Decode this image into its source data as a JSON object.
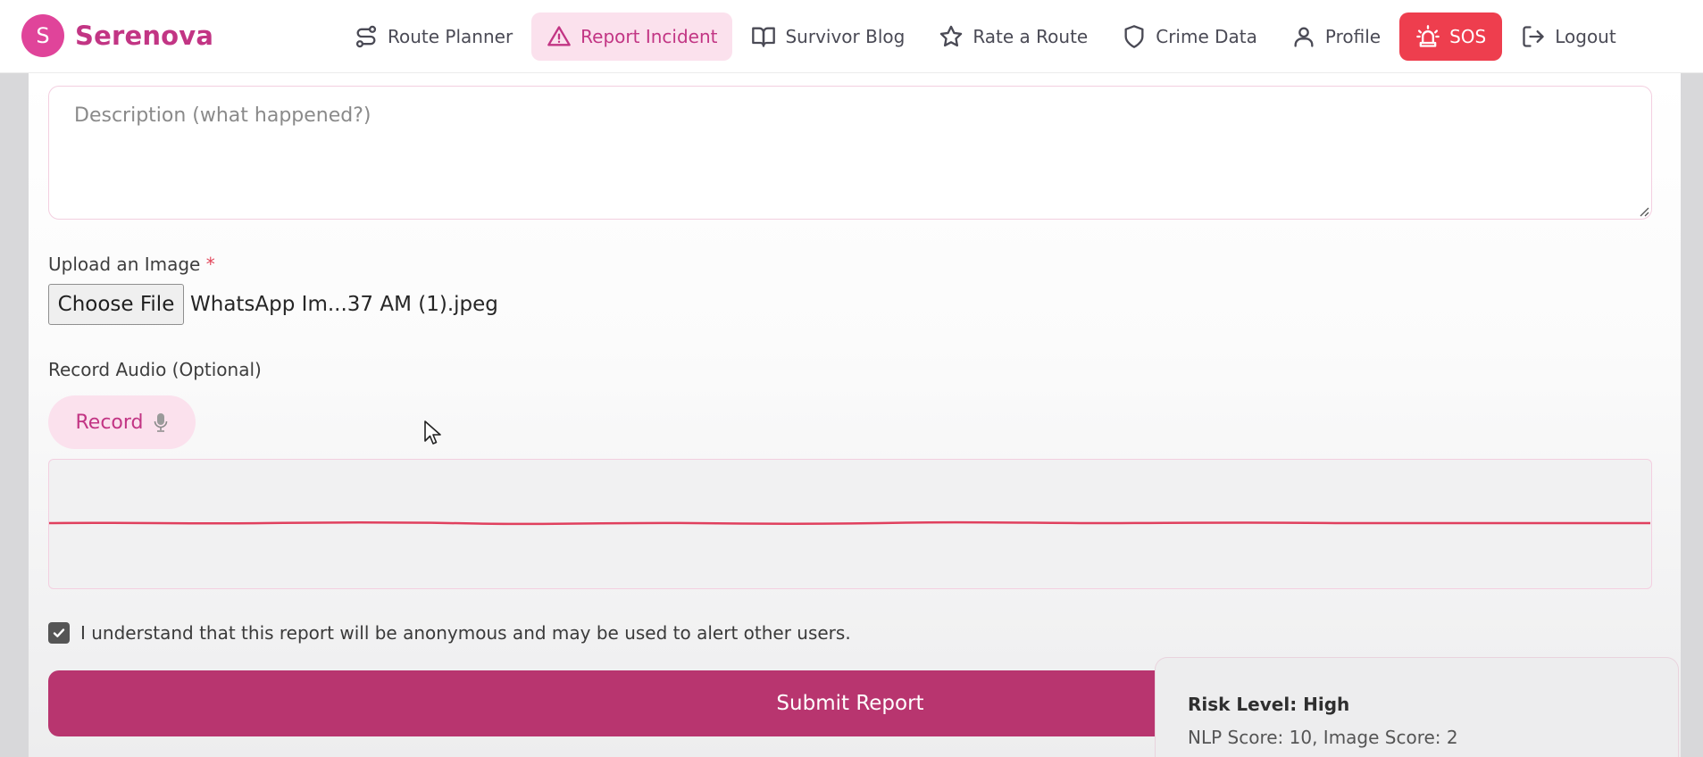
{
  "brand": {
    "logo_letter": "S",
    "name": "Serenova"
  },
  "nav": {
    "items": [
      {
        "label": "Route Planner",
        "icon": "route-icon"
      },
      {
        "label": "Report Incident",
        "icon": "warning-triangle-icon",
        "active": true
      },
      {
        "label": "Survivor Blog",
        "icon": "book-icon"
      },
      {
        "label": "Rate a Route",
        "icon": "star-icon"
      },
      {
        "label": "Crime Data",
        "icon": "shield-icon"
      },
      {
        "label": "Profile",
        "icon": "user-icon"
      },
      {
        "label": "SOS",
        "icon": "siren-icon"
      },
      {
        "label": "Logout",
        "icon": "logout-icon"
      }
    ]
  },
  "form": {
    "description_placeholder": "Description (what happened?)",
    "upload_label": "Upload an Image",
    "required_mark": "*",
    "choose_file_label": "Choose File",
    "file_name": "WhatsApp Im...37 AM (1).jpeg",
    "audio_label": "Record Audio (Optional)",
    "record_label": "Record",
    "consent_text": "I understand that this report will be anonymous and may be used to alert other users.",
    "consent_checked": true,
    "submit_label": "Submit Report"
  },
  "risk": {
    "level_text": "Risk Level: High",
    "scores_text": "NLP Score: 10, Image Score: 2"
  },
  "colors": {
    "brand": "#c23584",
    "brand_logo": "#e0449a",
    "active_tab_bg": "#fbe1ed",
    "sos": "#ee3e4e",
    "submit": "#b8356f",
    "waveform": "#e0405e"
  }
}
